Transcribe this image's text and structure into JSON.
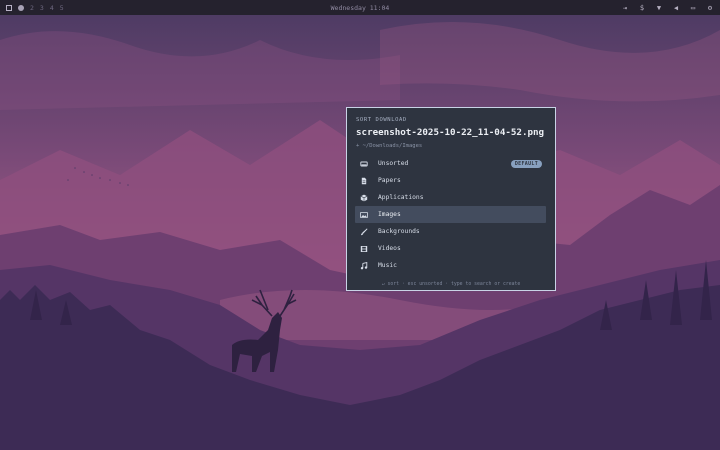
{
  "topbar": {
    "workspaces": [
      "2",
      "3",
      "4",
      "5"
    ],
    "clock": "Wednesday 11:04",
    "tray_icons": [
      "logout-icon",
      "dollar-icon",
      "wifi-icon",
      "volume-icon",
      "battery-icon",
      "settings-icon"
    ]
  },
  "dialog": {
    "title": "SORT DOWNLOAD",
    "filename": "screenshot-2025-10-22_11-04-52.png",
    "path": "+ ~/Downloads/Images",
    "items": [
      {
        "label": "Unsorted",
        "icon": "drive-icon",
        "badge": "DEFAULT"
      },
      {
        "label": "Papers",
        "icon": "document-icon"
      },
      {
        "label": "Applications",
        "icon": "package-icon"
      },
      {
        "label": "Images",
        "icon": "image-icon",
        "selected": true
      },
      {
        "label": "Backgrounds",
        "icon": "brush-icon"
      },
      {
        "label": "Videos",
        "icon": "film-icon"
      },
      {
        "label": "Music",
        "icon": "music-note-icon"
      }
    ],
    "hint": "↵ sort · esc unsorted · type to search or create"
  },
  "colors": {
    "accent": "#88a0bf",
    "dialog_bg": "#2e3440",
    "selection": "#434c5e",
    "topbar_bg": "#25222e"
  }
}
